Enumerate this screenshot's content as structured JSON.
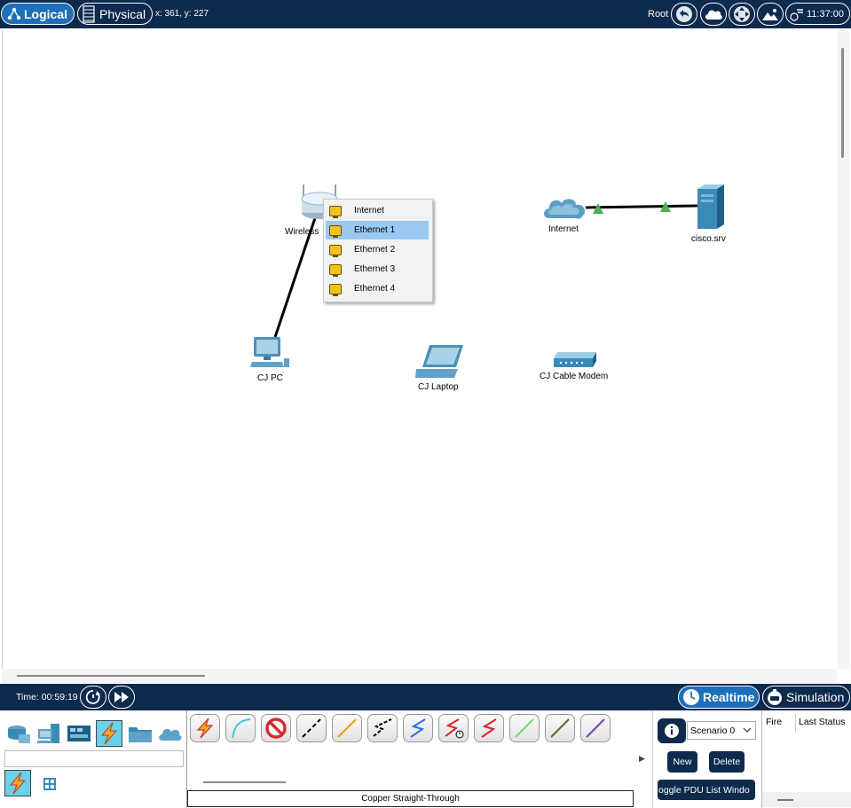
{
  "topbar": {
    "logical_label": "Logical",
    "physical_label": "Physical",
    "coords": "x: 361, y: 227",
    "root_label": "Root",
    "time": "11:37:00"
  },
  "devices": {
    "wireless_router": "Wireless",
    "internet_cloud": "Internet",
    "server": "cisco.srv",
    "pc": "CJ PC",
    "laptop": "CJ Laptop",
    "cable_modem": "CJ Cable Modem"
  },
  "context_menu": {
    "items": [
      "Internet",
      "Ethernet 1",
      "Ethernet 2",
      "Ethernet 3",
      "Ethernet 4"
    ],
    "selected": "Ethernet 1"
  },
  "timebar": {
    "time": "Time: 00:59:19",
    "realtime_label": "Realtime",
    "simulation_label": "Simulation"
  },
  "cables": {
    "selected_name": "Copper Straight-Through",
    "icons": [
      "automatic-connection",
      "console",
      "no-cable",
      "copper-straight-through",
      "copper-cross-over",
      "fiber",
      "phone",
      "coaxial",
      "serial-dce",
      "serial-dte",
      "octal",
      "iot-custom",
      "usb"
    ]
  },
  "scenario": {
    "selected": "Scenario 0",
    "new_label": "New",
    "delete_label": "Delete",
    "toggle_label": "oggle PDU List Windo"
  },
  "pdu_list": {
    "columns": [
      "Fire",
      "Last Status"
    ]
  },
  "colors": {
    "bar_bg": "#0e2a4d",
    "active_blue": "#1c6fb8",
    "menu_selected": "#99c9f3",
    "link_up": "#4caf50"
  }
}
